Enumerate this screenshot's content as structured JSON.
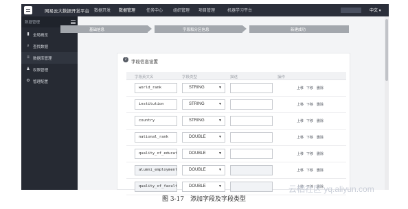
{
  "app": {
    "brand": "网易云大数据开发平台",
    "nav": [
      "数据开发",
      "数据管理",
      "任务中心",
      "组织管理",
      "项目管理",
      "机器学习平台"
    ],
    "active_nav_index": 1,
    "lang": "中文 ▾"
  },
  "sidebar": {
    "title": "数据管理",
    "items": [
      {
        "label": "全局概览",
        "icon": "bar-chart-icon"
      },
      {
        "label": "查找数据",
        "icon": "search-icon"
      },
      {
        "label": "数据库管理",
        "icon": "database-icon",
        "active": true
      },
      {
        "label": "权限管理",
        "icon": "users-icon"
      },
      {
        "label": "管理配置",
        "icon": "settings-icon"
      }
    ]
  },
  "steps": [
    "基础信息",
    "字段和分区信息",
    "新建成功"
  ],
  "section": {
    "number": "2",
    "title": "字段信息设置"
  },
  "table": {
    "headers": [
      "字段英文名",
      "字段类型",
      "描述",
      "操作"
    ],
    "actions": [
      "上移",
      "下移",
      "删除"
    ],
    "rows": [
      {
        "name": "world_rank",
        "type": "STRING",
        "desc": ""
      },
      {
        "name": "institution",
        "type": "STRING",
        "desc": ""
      },
      {
        "name": "country",
        "type": "STRING",
        "desc": ""
      },
      {
        "name": "national_rank",
        "type": "DOUBLE",
        "desc": ""
      },
      {
        "name": "quality_of_educat",
        "type": "DOUBLE",
        "desc": ""
      },
      {
        "name": "alumni_employment",
        "type": "DOUBLE",
        "desc": ""
      },
      {
        "name": "quality_of_facult",
        "type": "DOUBLE",
        "desc": ""
      }
    ]
  },
  "caption": "图 3-17　添加字段及字段类型",
  "watermark": "云栖社区 yq.aliyun.com"
}
